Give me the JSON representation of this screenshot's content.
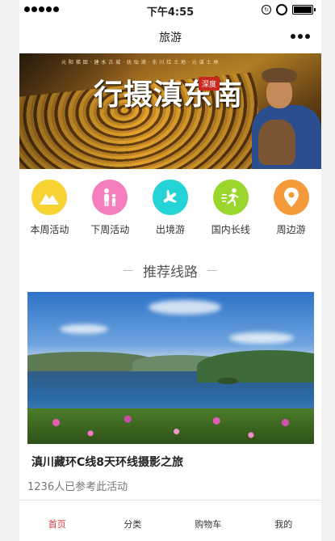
{
  "status_bar": {
    "time": "下午4:55"
  },
  "nav": {
    "title": "旅游"
  },
  "banner": {
    "subtitle": "元 阳 梯 田 · 建 水 古 城 · 抚 仙 湖 · 东 川 红 土 地 · 元 谋 土 林",
    "title": "行摄滇东南",
    "stamp": "深度",
    "slides": 3,
    "active_slide": 1
  },
  "categories": [
    {
      "label": "本周活动",
      "icon": "mountain-icon",
      "color": "#f6d233"
    },
    {
      "label": "下周活动",
      "icon": "family-icon",
      "color": "#f57fbe"
    },
    {
      "label": "出境游",
      "icon": "airplane-icon",
      "color": "#23d3d6"
    },
    {
      "label": "国内长线",
      "icon": "runner-icon",
      "color": "#9ad62c"
    },
    {
      "label": "周边游",
      "icon": "location-pin-icon",
      "color": "#f59a3a"
    }
  ],
  "section": {
    "title": "推荐线路"
  },
  "featured": {
    "title": "滇川藏环C线8天环线摄影之旅",
    "participants": "1236人已参考此活动"
  },
  "tabs": [
    {
      "label": "首页",
      "active": true
    },
    {
      "label": "分类",
      "active": false
    },
    {
      "label": "购物车",
      "active": false
    },
    {
      "label": "我的",
      "active": false
    }
  ],
  "colors": {
    "accent": "#d9363e"
  }
}
